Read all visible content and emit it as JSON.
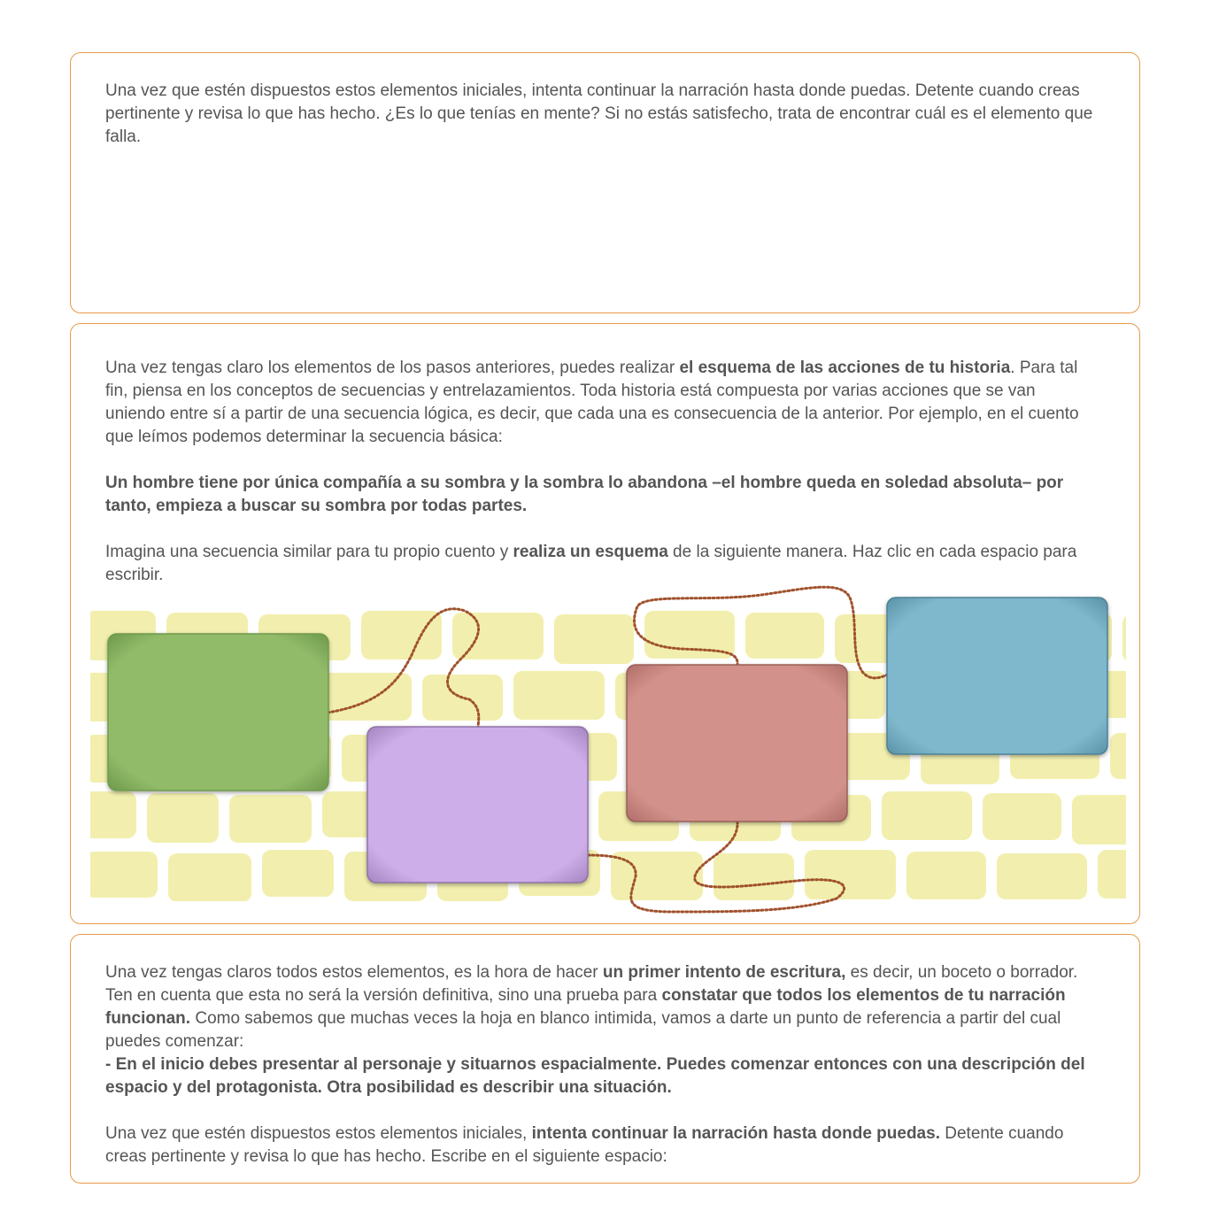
{
  "section1": {
    "text": "Una vez que estén dispuestos estos elementos iniciales, intenta continuar la narración hasta donde puedas. Detente cuando creas pertinente y revisa lo que has hecho. ¿Es lo que tenías en mente? Si no estás satisfecho, trata de encontrar cuál es el elemento que falla."
  },
  "section2": {
    "intro_1": "Una vez tengas claro los elementos de los pasos anteriores, puedes realizar ",
    "intro_bold": "el esquema de las acciones de tu historia",
    "intro_2": ". Para tal fin, piensa en los conceptos de secuencias y entrelazamientos. Toda historia está compuesta por varias acciones que se van uniendo entre sí a partir de una secuencia lógica, es decir, que cada una es consecuencia de la anterior. Por ejemplo, en el cuento que leímos podemos determinar la secuencia básica:",
    "sequence": "Un hombre tiene por única compañía a su sombra y la sombra lo abandona –el hombre queda en soledad absoluta– por tanto, empieza a buscar su sombra por todas partes.",
    "instr_1": "Imagina una secuencia similar para tu propio cuento y ",
    "instr_bold": "realiza un esquema",
    "instr_2": " de la siguiente manera. Haz clic en cada espacio para escribir."
  },
  "scheme": {
    "boxes": [
      {
        "name": "scheme-box-green",
        "fill": "#91bb69",
        "edge": "#5f8a42"
      },
      {
        "name": "scheme-box-purple",
        "fill": "#ceaee8",
        "edge": "#8f72a8"
      },
      {
        "name": "scheme-box-rose",
        "fill": "#d2918b",
        "edge": "#9a5e58"
      },
      {
        "name": "scheme-box-blue",
        "fill": "#7fb8cc",
        "edge": "#4d8196"
      }
    ],
    "brick_color": "#f2efae",
    "connector_color": "#a0522d"
  },
  "section3": {
    "p1_a": "Una vez tengas claros todos estos elementos, es la hora de hacer ",
    "p1_bold1": "un primer intento de escritura,",
    "p1_b": " es decir, un boceto o borrador. Ten en cuenta que esta no será la versión definitiva, sino una prueba para ",
    "p1_bold2": "constatar que todos los elementos de tu narración funcionan.",
    "p1_c": " Como sabemos que muchas veces la hoja en blanco intimida, vamos a darte un punto de referencia a partir del cual puedes comenzar:",
    "p1_bullet": "- En el inicio debes presentar al personaje y situarnos espacialmente. Puedes comenzar entonces con una descripción del espacio y del protagonista. Otra posibilidad es describir una situación.",
    "p2_a": "Una vez que estén dispuestos estos elementos iniciales, ",
    "p2_bold": "intenta continuar la narración hasta donde puedas.",
    "p2_b": " Detente cuando creas pertinente y revisa lo que has hecho. Escribe en el siguiente espacio:"
  }
}
